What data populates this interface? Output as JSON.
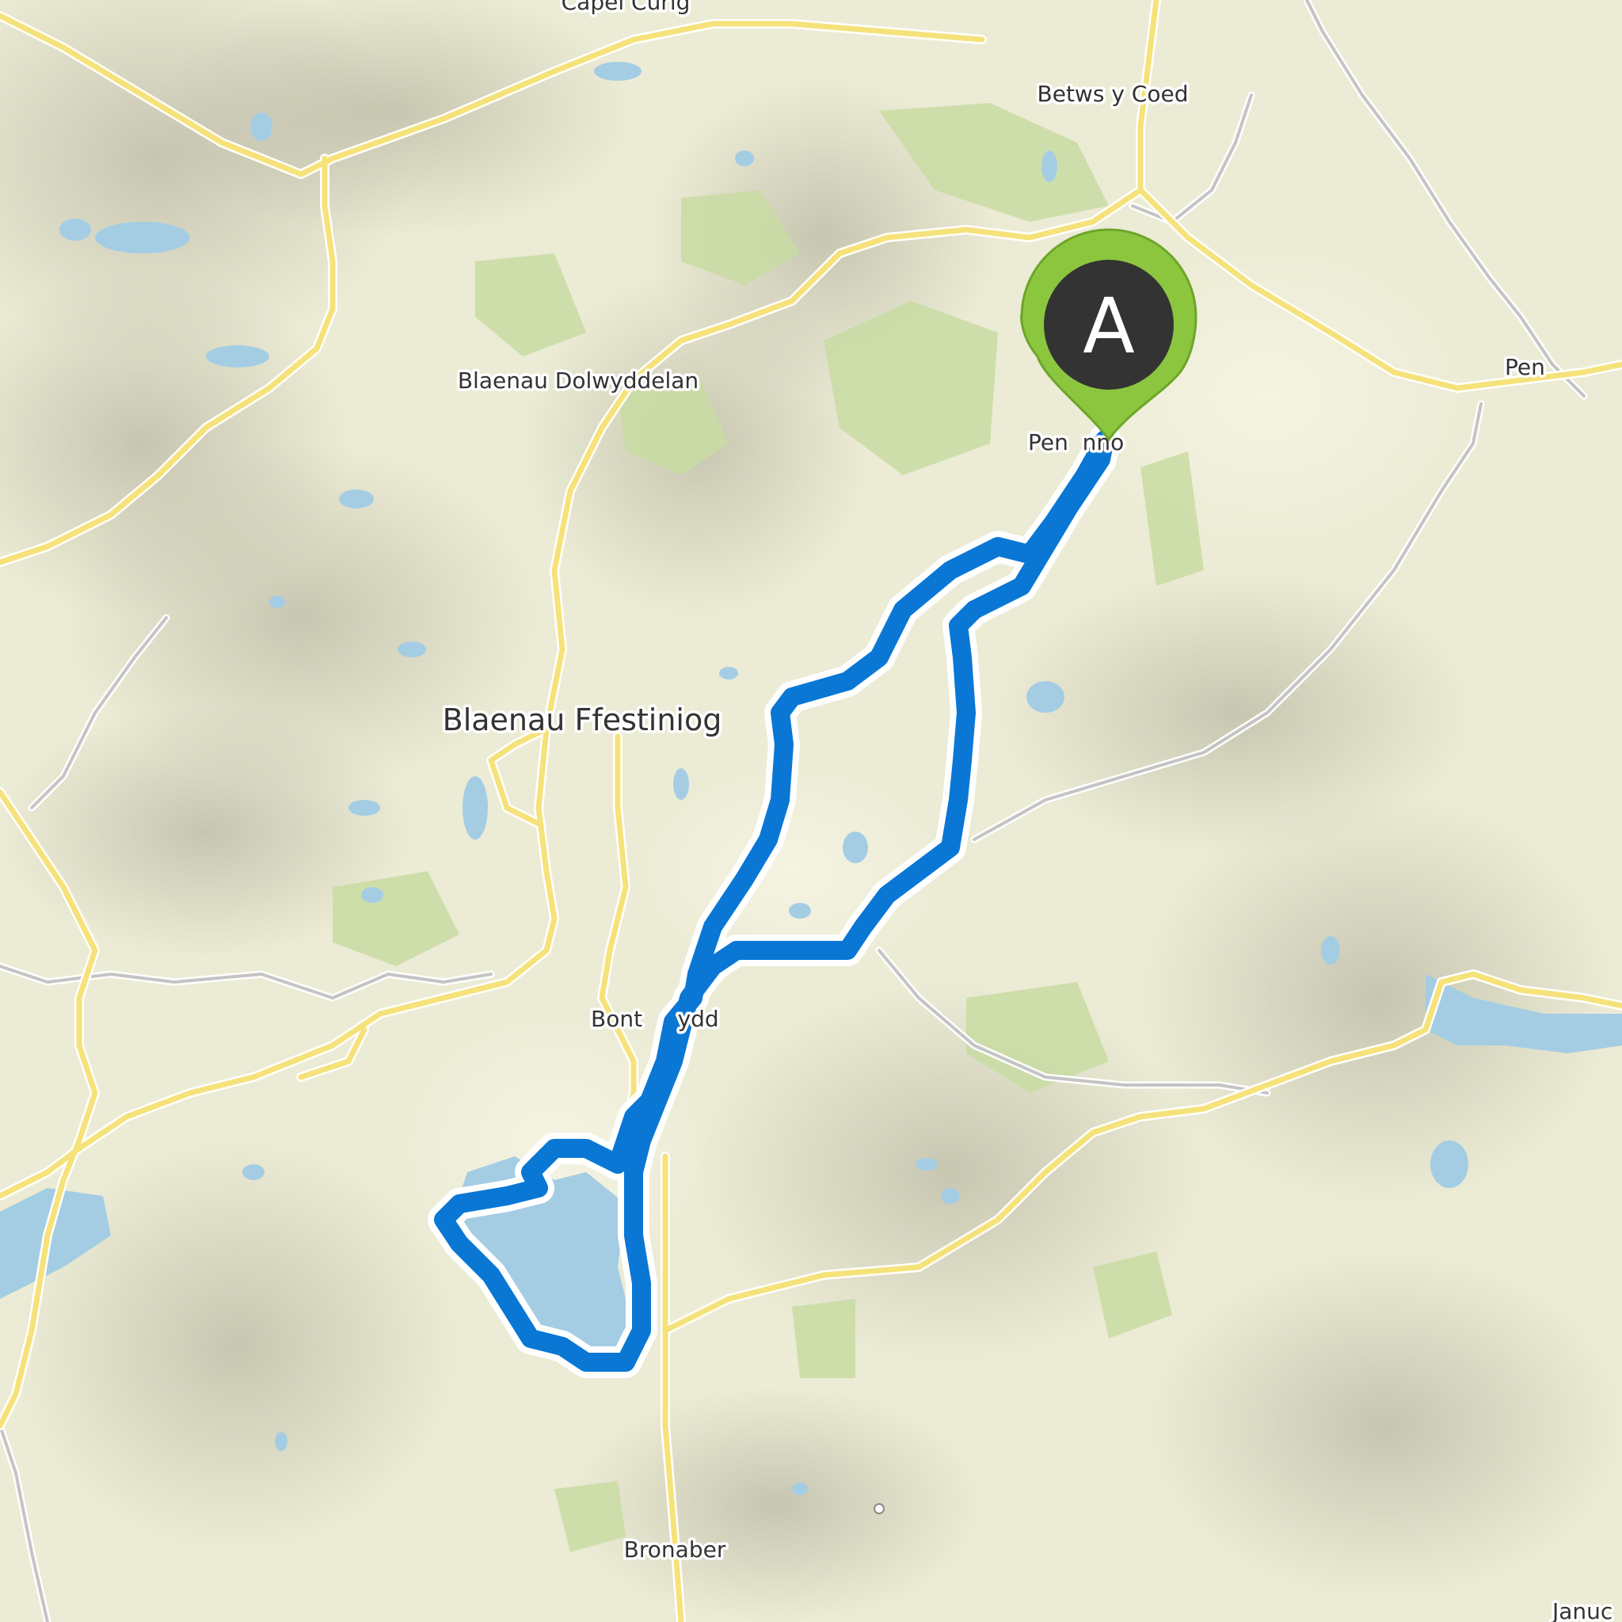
{
  "map": {
    "labels": [
      {
        "id": "capel-curig",
        "text": "Capel Curig"
      },
      {
        "id": "betws-y-coed",
        "text": "Betws y Coed"
      },
      {
        "id": "blaenau-dolwyddelan",
        "text": "Blaenau Dolwyddelan"
      },
      {
        "id": "pentrefoelas",
        "text": "Pen"
      },
      {
        "id": "penmachno",
        "text": "Pen  nno"
      },
      {
        "id": "blaenau-ffestiniog",
        "text": "Blaenau Ffestiniog"
      },
      {
        "id": "bont-newydd",
        "text": "Bont     ydd"
      },
      {
        "id": "bronaber",
        "text": "Bronaber"
      },
      {
        "id": "january",
        "text": "Januc"
      }
    ],
    "start_marker": {
      "letter": "A",
      "color": "#8cc63f",
      "core_color": "#333333"
    },
    "route": {
      "color": "#0a77d5"
    },
    "water_color": "#a4cde4",
    "road_color": "#f6e27a",
    "minor_road_color": "#c8c8c8",
    "forest_color": "#c8dca2"
  }
}
